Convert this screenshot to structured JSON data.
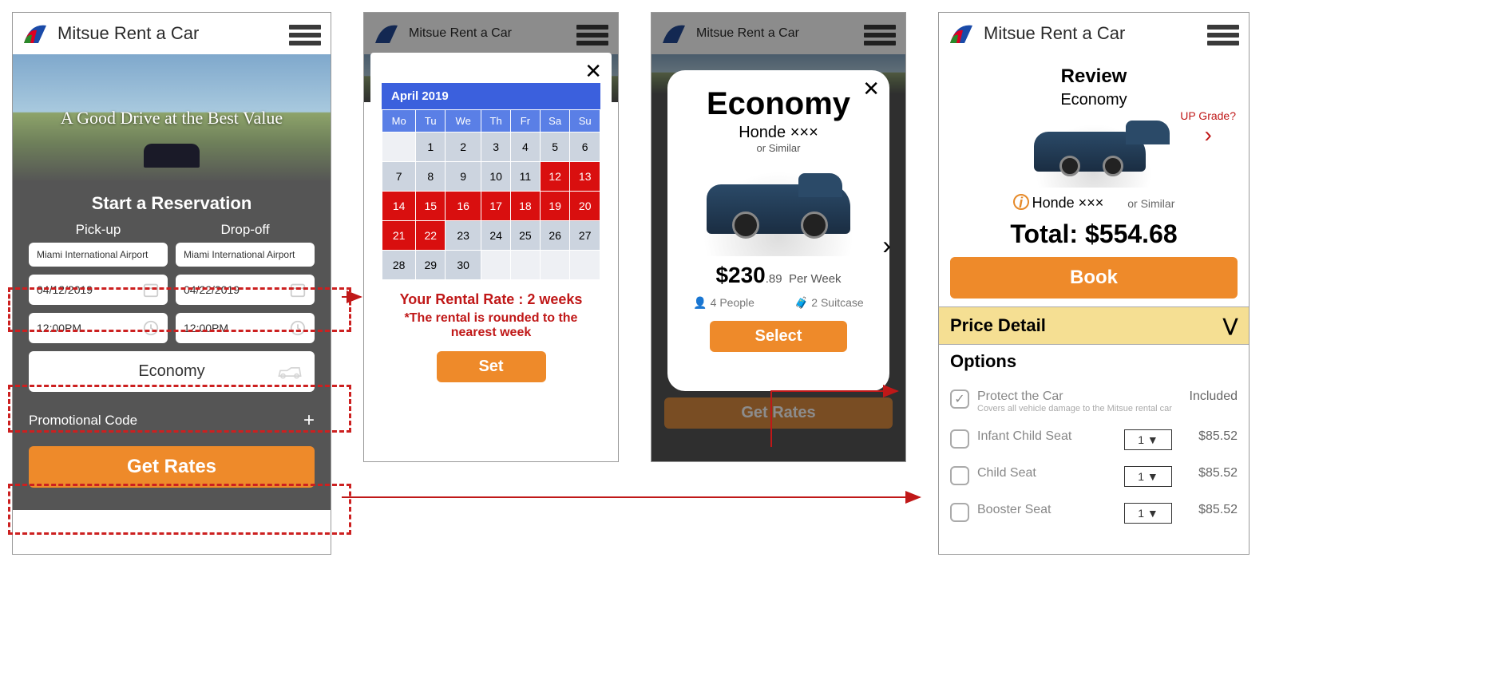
{
  "brand": "Mitsue Rent a Car",
  "hero_tagline": "A Good Drive at the Best Value",
  "reservation": {
    "title": "Start a Reservation",
    "pickup_label": "Pick-up",
    "dropoff_label": "Drop-off",
    "pickup_location": "Miami International Airport",
    "dropoff_location": "Miami International Airport",
    "pickup_date": "04/12/2019",
    "dropoff_date": "04/22/2019",
    "pickup_time": "12:00PM",
    "dropoff_time": "12:00PM",
    "car_class": "Economy",
    "promo_label": "Promotional Code",
    "get_rates": "Get Rates"
  },
  "calendar": {
    "month": "April 2019",
    "dow": [
      "Mo",
      "Tu",
      "We",
      "Th",
      "Fr",
      "Sa",
      "Su"
    ],
    "weeks": [
      [
        "",
        "1",
        "2",
        "3",
        "4",
        "5",
        "6"
      ],
      [
        "7",
        "8",
        "9",
        "10",
        "11",
        "12",
        "13"
      ],
      [
        "14",
        "15",
        "16",
        "17",
        "18",
        "19",
        "20"
      ],
      [
        "21",
        "22",
        "23",
        "24",
        "25",
        "26",
        "27"
      ],
      [
        "28",
        "29",
        "30",
        "",
        "",
        "",
        ""
      ]
    ],
    "selected": [
      "12",
      "13",
      "14",
      "15",
      "16",
      "17",
      "18",
      "19",
      "20",
      "21",
      "22"
    ],
    "rate_msg": "Your Rental Rate : 2 weeks",
    "rate_note": "*The rental is rounded to the nearest week",
    "set": "Set"
  },
  "car_card": {
    "title": "Economy",
    "model": "Honde ×××",
    "similar": "or Similar",
    "price_main": "$230",
    "price_cents": ".89",
    "price_unit": "Per Week",
    "people": "4 People",
    "suitcase": "2 Suitcase",
    "select": "Select",
    "get_rates": "Get Rates"
  },
  "review": {
    "title": "Review",
    "class": "Economy",
    "upgrade": "UP Grade?",
    "model": "Honde ×××",
    "similar": "or Similar",
    "total_label": "Total:",
    "total_value": "$554.68",
    "book": "Book",
    "price_detail": "Price Detail",
    "options_title": "Options",
    "options": [
      {
        "label": "Protect the Car",
        "desc": "Covers all vehicle damage to the Mitsue rental car",
        "price": "Included",
        "checked": true,
        "qty": ""
      },
      {
        "label": "Infant Child Seat",
        "desc": "",
        "price": "$85.52",
        "checked": false,
        "qty": "1"
      },
      {
        "label": "Child Seat",
        "desc": "",
        "price": "$85.52",
        "checked": false,
        "qty": "1"
      },
      {
        "label": "Booster Seat",
        "desc": "",
        "price": "$85.52",
        "checked": false,
        "qty": "1"
      }
    ]
  }
}
